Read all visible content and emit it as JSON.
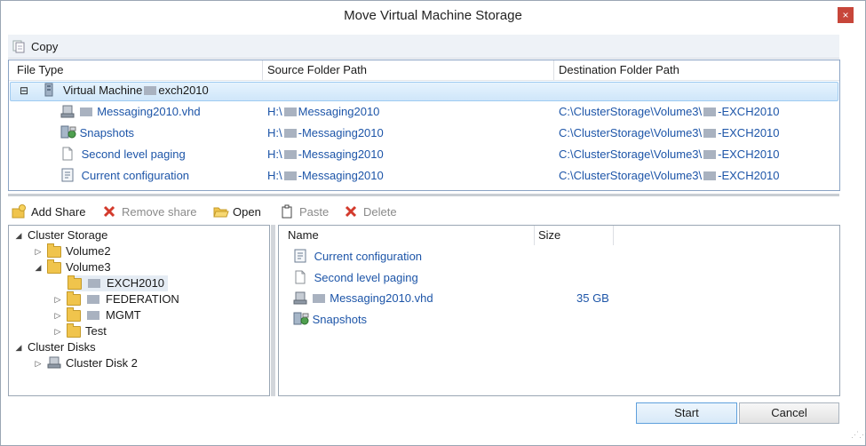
{
  "window": {
    "title": "Move Virtual Machine Storage",
    "close_glyph": "×"
  },
  "toolbar_top": {
    "copy_label": "Copy"
  },
  "grid": {
    "headers": {
      "file_type": "File Type",
      "source": "Source Folder Path",
      "destination": "Destination Folder Path"
    },
    "vm_row": {
      "toggle": "⊟",
      "name_prefix": "Virtual Machine",
      "name_suffix": "exch2010"
    },
    "rows": [
      {
        "icon": "vhd-disk-icon",
        "name": "Messaging2010.vhd",
        "src_prefix": "H:\\",
        "src_suffix": "Messaging2010",
        "dst_prefix": "C:\\ClusterStorage\\Volume3\\",
        "dst_suffix": "-EXCH2010"
      },
      {
        "icon": "snapshots-icon",
        "name": "Snapshots",
        "src_prefix": "H:\\",
        "src_suffix": "-Messaging2010",
        "dst_prefix": "C:\\ClusterStorage\\Volume3\\",
        "dst_suffix": "-EXCH2010"
      },
      {
        "icon": "document-icon",
        "name": "Second level paging",
        "src_prefix": "H:\\",
        "src_suffix": "-Messaging2010",
        "dst_prefix": "C:\\ClusterStorage\\Volume3\\",
        "dst_suffix": "-EXCH2010"
      },
      {
        "icon": "config-icon",
        "name": "Current configuration",
        "src_prefix": "H:\\",
        "src_suffix": "-Messaging2010",
        "dst_prefix": "C:\\ClusterStorage\\Volume3\\",
        "dst_suffix": "-EXCH2010"
      }
    ]
  },
  "toolbar_bottom": {
    "add_share": "Add Share",
    "remove_share": "Remove share",
    "open": "Open",
    "paste": "Paste",
    "delete": "Delete"
  },
  "tree": {
    "cluster_storage": "Cluster Storage",
    "volume2": "Volume2",
    "volume3": "Volume3",
    "exch2010": "EXCH2010",
    "federation": "FEDERATION",
    "mgmt": "MGMT",
    "test": "Test",
    "cluster_disks": "Cluster Disks",
    "cluster_disk2": "Cluster Disk 2"
  },
  "list": {
    "headers": {
      "name": "Name",
      "size": "Size"
    },
    "items": [
      {
        "name": "Current configuration",
        "size": ""
      },
      {
        "name": "Second level paging",
        "size": ""
      },
      {
        "name": "Messaging2010.vhd",
        "size": "35 GB"
      },
      {
        "name": "Snapshots",
        "size": ""
      }
    ]
  },
  "buttons": {
    "start": "Start",
    "cancel": "Cancel"
  },
  "colors": {
    "link_blue": "#1d55a8",
    "selection": "#cfe6fa",
    "close_red": "#c7463a"
  }
}
